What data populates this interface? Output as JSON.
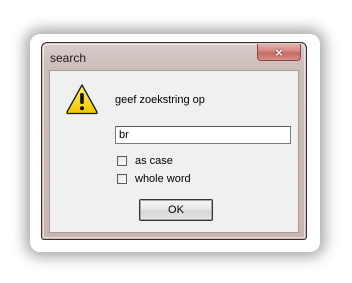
{
  "window": {
    "title": "search",
    "close_glyph": "×"
  },
  "dialog": {
    "icon": "warning-icon",
    "prompt": "geef zoekstring op",
    "search_value": "br",
    "options": [
      {
        "label": "as case",
        "checked": false
      },
      {
        "label": "whole word",
        "checked": false
      }
    ],
    "ok_label": "OK"
  },
  "colors": {
    "title_bar": "#cdbdbb",
    "close_button": "#c56b62",
    "client_bg": "#f0f0f0",
    "warning_yellow": "#f5d000"
  }
}
